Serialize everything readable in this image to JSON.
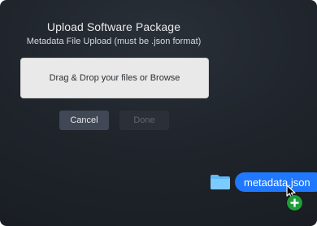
{
  "dialog": {
    "title": "Upload Software Package",
    "subtitle": "Metadata File Upload (must be .json format)",
    "dropzone_label": "Drag & Drop your files or Browse",
    "buttons": {
      "cancel": "Cancel",
      "done": "Done"
    }
  },
  "drag": {
    "file_name": "metadata.json",
    "icons": {
      "folder": "folder-icon",
      "cursor": "cursor-arrow-icon",
      "add": "plus-icon"
    }
  },
  "colors": {
    "background": "#1f242b",
    "dropzone": "#e9e9e9",
    "cancel_button": "#3f4854",
    "done_button_disabled": "#2b3038",
    "drag_pill": "#1f78ff",
    "plus_badge": "#1f9d3a",
    "folder": "#6cc0ff"
  }
}
